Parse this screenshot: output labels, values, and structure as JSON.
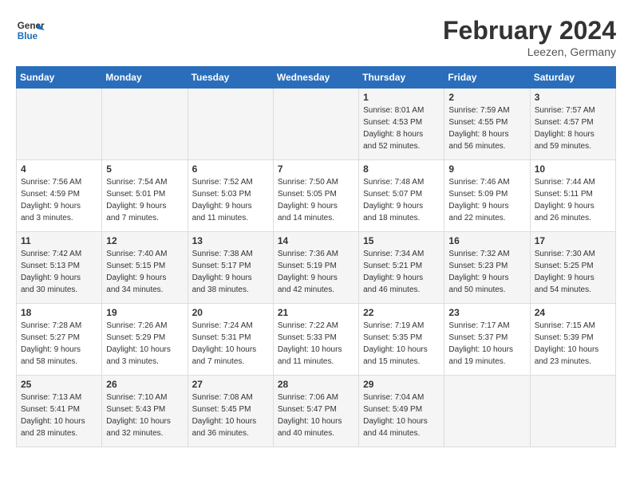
{
  "logo": {
    "line1": "General",
    "line2": "Blue"
  },
  "title": "February 2024",
  "location": "Leezen, Germany",
  "days_header": [
    "Sunday",
    "Monday",
    "Tuesday",
    "Wednesday",
    "Thursday",
    "Friday",
    "Saturday"
  ],
  "weeks": [
    [
      {
        "day": "",
        "info": ""
      },
      {
        "day": "",
        "info": ""
      },
      {
        "day": "",
        "info": ""
      },
      {
        "day": "",
        "info": ""
      },
      {
        "day": "1",
        "info": "Sunrise: 8:01 AM\nSunset: 4:53 PM\nDaylight: 8 hours\nand 52 minutes."
      },
      {
        "day": "2",
        "info": "Sunrise: 7:59 AM\nSunset: 4:55 PM\nDaylight: 8 hours\nand 56 minutes."
      },
      {
        "day": "3",
        "info": "Sunrise: 7:57 AM\nSunset: 4:57 PM\nDaylight: 8 hours\nand 59 minutes."
      }
    ],
    [
      {
        "day": "4",
        "info": "Sunrise: 7:56 AM\nSunset: 4:59 PM\nDaylight: 9 hours\nand 3 minutes."
      },
      {
        "day": "5",
        "info": "Sunrise: 7:54 AM\nSunset: 5:01 PM\nDaylight: 9 hours\nand 7 minutes."
      },
      {
        "day": "6",
        "info": "Sunrise: 7:52 AM\nSunset: 5:03 PM\nDaylight: 9 hours\nand 11 minutes."
      },
      {
        "day": "7",
        "info": "Sunrise: 7:50 AM\nSunset: 5:05 PM\nDaylight: 9 hours\nand 14 minutes."
      },
      {
        "day": "8",
        "info": "Sunrise: 7:48 AM\nSunset: 5:07 PM\nDaylight: 9 hours\nand 18 minutes."
      },
      {
        "day": "9",
        "info": "Sunrise: 7:46 AM\nSunset: 5:09 PM\nDaylight: 9 hours\nand 22 minutes."
      },
      {
        "day": "10",
        "info": "Sunrise: 7:44 AM\nSunset: 5:11 PM\nDaylight: 9 hours\nand 26 minutes."
      }
    ],
    [
      {
        "day": "11",
        "info": "Sunrise: 7:42 AM\nSunset: 5:13 PM\nDaylight: 9 hours\nand 30 minutes."
      },
      {
        "day": "12",
        "info": "Sunrise: 7:40 AM\nSunset: 5:15 PM\nDaylight: 9 hours\nand 34 minutes."
      },
      {
        "day": "13",
        "info": "Sunrise: 7:38 AM\nSunset: 5:17 PM\nDaylight: 9 hours\nand 38 minutes."
      },
      {
        "day": "14",
        "info": "Sunrise: 7:36 AM\nSunset: 5:19 PM\nDaylight: 9 hours\nand 42 minutes."
      },
      {
        "day": "15",
        "info": "Sunrise: 7:34 AM\nSunset: 5:21 PM\nDaylight: 9 hours\nand 46 minutes."
      },
      {
        "day": "16",
        "info": "Sunrise: 7:32 AM\nSunset: 5:23 PM\nDaylight: 9 hours\nand 50 minutes."
      },
      {
        "day": "17",
        "info": "Sunrise: 7:30 AM\nSunset: 5:25 PM\nDaylight: 9 hours\nand 54 minutes."
      }
    ],
    [
      {
        "day": "18",
        "info": "Sunrise: 7:28 AM\nSunset: 5:27 PM\nDaylight: 9 hours\nand 58 minutes."
      },
      {
        "day": "19",
        "info": "Sunrise: 7:26 AM\nSunset: 5:29 PM\nDaylight: 10 hours\nand 3 minutes."
      },
      {
        "day": "20",
        "info": "Sunrise: 7:24 AM\nSunset: 5:31 PM\nDaylight: 10 hours\nand 7 minutes."
      },
      {
        "day": "21",
        "info": "Sunrise: 7:22 AM\nSunset: 5:33 PM\nDaylight: 10 hours\nand 11 minutes."
      },
      {
        "day": "22",
        "info": "Sunrise: 7:19 AM\nSunset: 5:35 PM\nDaylight: 10 hours\nand 15 minutes."
      },
      {
        "day": "23",
        "info": "Sunrise: 7:17 AM\nSunset: 5:37 PM\nDaylight: 10 hours\nand 19 minutes."
      },
      {
        "day": "24",
        "info": "Sunrise: 7:15 AM\nSunset: 5:39 PM\nDaylight: 10 hours\nand 23 minutes."
      }
    ],
    [
      {
        "day": "25",
        "info": "Sunrise: 7:13 AM\nSunset: 5:41 PM\nDaylight: 10 hours\nand 28 minutes."
      },
      {
        "day": "26",
        "info": "Sunrise: 7:10 AM\nSunset: 5:43 PM\nDaylight: 10 hours\nand 32 minutes."
      },
      {
        "day": "27",
        "info": "Sunrise: 7:08 AM\nSunset: 5:45 PM\nDaylight: 10 hours\nand 36 minutes."
      },
      {
        "day": "28",
        "info": "Sunrise: 7:06 AM\nSunset: 5:47 PM\nDaylight: 10 hours\nand 40 minutes."
      },
      {
        "day": "29",
        "info": "Sunrise: 7:04 AM\nSunset: 5:49 PM\nDaylight: 10 hours\nand 44 minutes."
      },
      {
        "day": "",
        "info": ""
      },
      {
        "day": "",
        "info": ""
      }
    ]
  ]
}
